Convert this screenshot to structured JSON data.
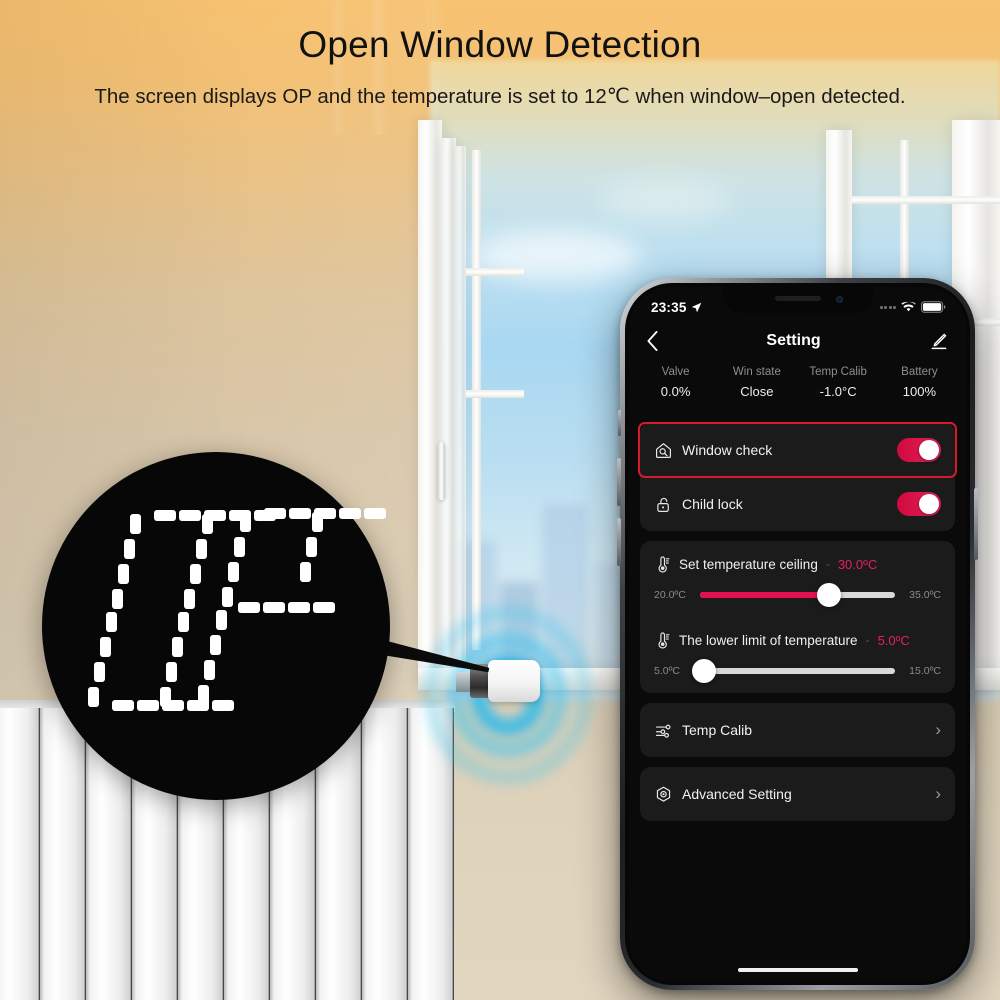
{
  "header": {
    "title": "Open Window Detection",
    "subtitle": "The screen displays OP and the temperature is set to 12℃ when window–open detected."
  },
  "device_display": {
    "text": "OP",
    "style": "segmented-lcd",
    "background_color": "#070707",
    "segment_color": "#ffffff"
  },
  "phone": {
    "statusbar": {
      "time": "23:35",
      "location_icon": "location-arrow-icon",
      "signal_icon": "signal-dots-icon",
      "wifi_icon": "wifi-icon",
      "battery_icon": "battery-full-icon"
    },
    "navbar": {
      "back_icon": "chevron-left-icon",
      "title": "Setting",
      "edit_icon": "pencil-edit-icon"
    },
    "summary": [
      {
        "label": "Valve",
        "value": "0.0%"
      },
      {
        "label": "Win state",
        "value": "Close"
      },
      {
        "label": "Temp Calib",
        "value": "-1.0°C"
      },
      {
        "label": "Battery",
        "value": "100%"
      }
    ],
    "toggles": [
      {
        "icon": "house-search-icon",
        "label": "Window check",
        "state": "on",
        "highlighted": true,
        "highlight_color": "#d41a2b"
      },
      {
        "icon": "open-padlock-icon",
        "label": "Child lock",
        "state": "on",
        "highlighted": false
      }
    ],
    "sliders": [
      {
        "icon": "thermometer-icon",
        "label": "Set temperature ceiling",
        "separator": "-",
        "value": "30.0ºC",
        "min_label": "20.0ºC",
        "max_label": "35.0ºC",
        "min": 20,
        "max": 35,
        "current": 30,
        "percent": 66,
        "fill_color": "#e3104f",
        "track_color": "#d8d8d8"
      },
      {
        "icon": "thermometer-icon",
        "label": "The lower limit of temperature",
        "separator": "-",
        "value": "5.0ºC",
        "min_label": "5.0ºC",
        "max_label": "15.0ºC",
        "min": 5,
        "max": 15,
        "current": 5,
        "percent": 0,
        "fill_color": "#e3104f",
        "track_color": "#d8d8d8"
      }
    ],
    "nav_rows": [
      {
        "icon": "sliders-icon",
        "label": "Temp Calib",
        "chevron": "›"
      },
      {
        "icon": "hex-target-icon",
        "label": "Advanced Setting",
        "chevron": "›"
      }
    ]
  },
  "colors": {
    "accent_red": "#e3215c",
    "highlight_red": "#d41a2b",
    "card_bg": "#1b1b1b",
    "screen_bg": "#0a0a0a",
    "wave_blue": "#39c4ef"
  }
}
